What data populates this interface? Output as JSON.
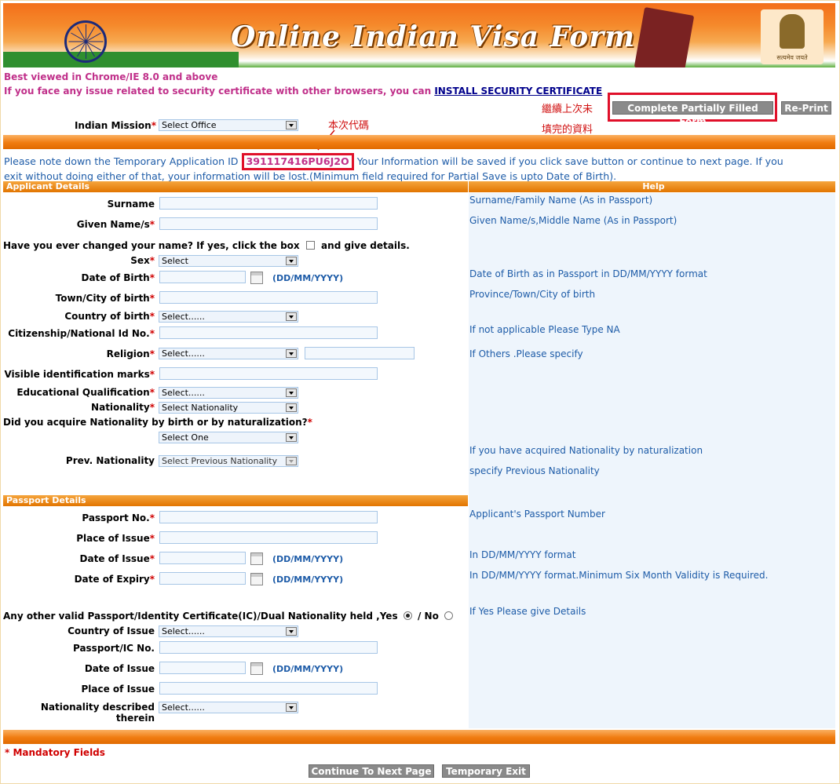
{
  "banner": {
    "title": "Online Indian Visa Form",
    "emblem_motto": "सत्यमेव जयते"
  },
  "browser_note": "Best viewed in Chrome/IE 8.0 and above",
  "cert_note": {
    "text": "If you face any issue related to security certificate with other browsers, you can",
    "link": "INSTALL SECURITY CERTIFICATE"
  },
  "annotations": {
    "resume_line1": "繼續上次未",
    "resume_line2": "填完的資料",
    "code_label": "本次代碼"
  },
  "top_buttons": {
    "complete": "Complete Partially Filled Form",
    "reprint": "Re-Print"
  },
  "mission": {
    "label": "Indian Mission",
    "value": "Select Office"
  },
  "temp_id": {
    "prefix": "Please note down the Temporary Application ID",
    "id": "391117416PU6J2O",
    "suffix": "Your Information will be saved if you click save button or continue to next page. If you",
    "line2": "exit without doing either of that, your information will be lost.(Minimum field required for Partial Save is upto Date of Birth)."
  },
  "sections": {
    "applicant": "Applicant Details",
    "help": "Help",
    "passport": "Passport Details"
  },
  "applicant": {
    "surname": "Surname",
    "given": "Given Name/s",
    "changed_q": "Have you ever changed your name? If yes, click the box",
    "changed_tail": "and give details.",
    "sex": "Sex",
    "sex_val": "Select",
    "dob": "Date of Birth",
    "fmt": "(DD/MM/YYYY)",
    "town": "Town/City of birth",
    "country": "Country of birth",
    "country_val": "Select......",
    "citizen": "Citizenship/National Id No.",
    "religion": "Religion",
    "religion_val": "Select......",
    "marks": "Visible identification marks",
    "edu": "Educational Qualification",
    "edu_val": "Select......",
    "nationality": "Nationality",
    "nationality_val": "Select Nationality",
    "acquire_q": "Did you acquire Nationality by birth or by naturalization?",
    "acquire_val": "Select One",
    "prev": "Prev. Nationality",
    "prev_val": "Select Previous Nationality"
  },
  "help": {
    "surname": "Surname/Family Name (As in Passport)",
    "given": "Given Name/s,Middle Name (As in Passport)",
    "dob": "Date of Birth as in Passport in DD/MM/YYYY format",
    "town": "Province/Town/City of birth",
    "citizen": "If not applicable Please Type NA",
    "religion": "If Others .Please specify",
    "prev1": "If you have acquired Nationality by naturalization",
    "prev2": "specify Previous Nationality",
    "passport_no": "Applicant's Passport Number",
    "issue": "In DD/MM/YYYY format",
    "expiry": "In DD/MM/YYYY format.Minimum Six Month Validity is Required.",
    "other": "If Yes Please give Details"
  },
  "passport": {
    "no": "Passport No.",
    "place": "Place of Issue",
    "date_issue": "Date of Issue",
    "date_expiry": "Date of Expiry",
    "other_q": "Any other valid Passport/Identity Certificate(IC)/Dual Nationality held ,Yes",
    "no_label": "/ No",
    "country": "Country of Issue",
    "country_val": "Select......",
    "ic_no": "Passport/IC No.",
    "ic_date": "Date of Issue",
    "ic_place": "Place of Issue",
    "nat_desc": "Nationality described therein",
    "nat_desc_val": "Select......"
  },
  "footer": {
    "mandatory": "* Mandatory Fields",
    "continue": "Continue To Next Page",
    "exit": "Temporary Exit"
  },
  "required_mark": "*"
}
